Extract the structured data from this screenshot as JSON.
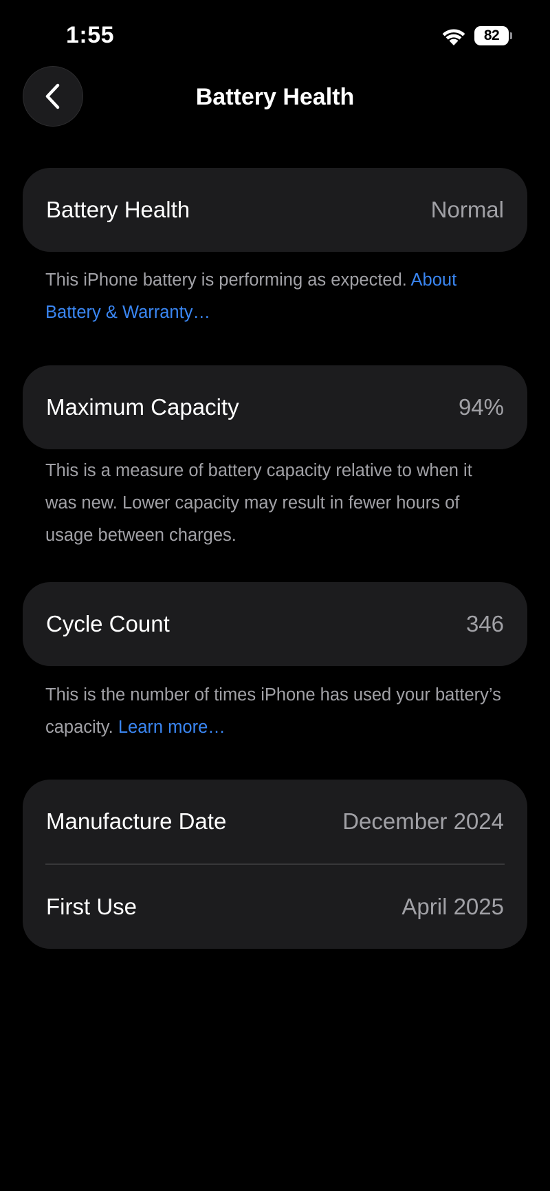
{
  "status_bar": {
    "time": "1:55",
    "battery_level": "82"
  },
  "nav": {
    "title": "Battery Health",
    "back_icon": "chevron-left-icon"
  },
  "sections": {
    "health": {
      "label": "Battery Health",
      "value": "Normal",
      "footnote": "This iPhone battery is performing as expected.",
      "footnote_link": "About Battery & Warranty…"
    },
    "capacity": {
      "label": "Maximum Capacity",
      "value": "94%",
      "footnote": "This is a measure of battery capacity relative to when it was new. Lower capacity may result in fewer hours of usage between charges."
    },
    "cycles": {
      "label": "Cycle Count",
      "value": "346",
      "footnote": "This is the number of times iPhone has used your battery’s capacity.",
      "footnote_link": "Learn more…"
    },
    "dates": {
      "manufacture_label": "Manufacture Date",
      "manufacture_value": "December 2024",
      "first_use_label": "First Use",
      "first_use_value": "April 2025"
    }
  },
  "colors": {
    "background": "#000000",
    "card": "#1c1c1e",
    "secondary_text": "#a1a1a6",
    "link": "#3a86f2"
  }
}
